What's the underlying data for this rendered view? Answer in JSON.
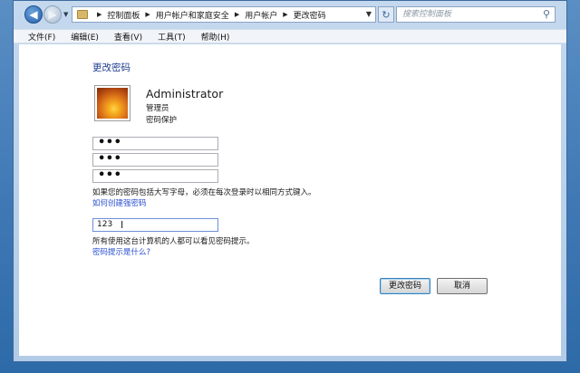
{
  "addressbar": {
    "breadcrumbs": [
      "控制面板",
      "用户帐户和家庭安全",
      "用户帐户",
      "更改密码"
    ],
    "search_placeholder": "搜索控制面板"
  },
  "menu": [
    "文件(F)",
    "编辑(E)",
    "查看(V)",
    "工具(T)",
    "帮助(H)"
  ],
  "page": {
    "title": "更改密码",
    "account": {
      "name": "Administrator",
      "role": "管理员",
      "status": "密码保护"
    },
    "fields": {
      "current_password": "•••",
      "new_password": "•••",
      "confirm_password": "•••",
      "hint": "123"
    },
    "case_note": "如果您的密码包括大写字母，必须在每次登录时以相同方式键入。",
    "strong_password_link": "如何创建强密码",
    "hint_note": "所有使用这台计算机的人都可以看见密码提示。",
    "hint_link": "密码提示是什么?",
    "buttons": {
      "change": "更改密码",
      "cancel": "取消"
    }
  },
  "icons": {
    "back": "back-arrow-icon",
    "forward": "forward-arrow-icon",
    "refresh": "refresh-icon",
    "search": "search-icon"
  }
}
